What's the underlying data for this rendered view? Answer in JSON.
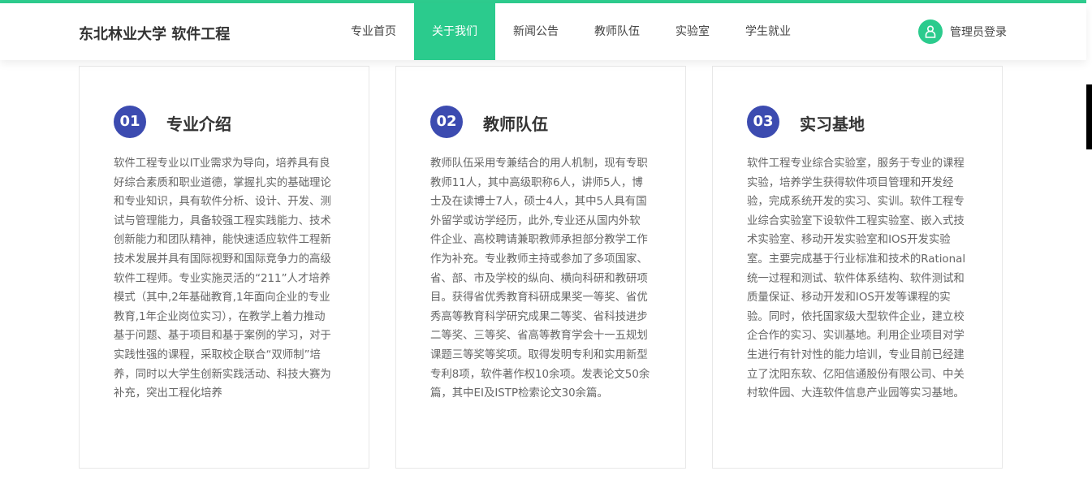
{
  "header": {
    "logo": "东北林业大学 软件工程",
    "nav": [
      "专业首页",
      "关于我们",
      "新闻公告",
      "教师队伍",
      "实验室",
      "学生就业"
    ],
    "active_index": 1,
    "login": "管理员登录"
  },
  "colors": {
    "accent": "#2bcb8d",
    "badge": "#3c4bb0"
  },
  "cards": [
    {
      "num": "01",
      "title": "专业介绍",
      "body": "软件工程专业以IT业需求为导向，培养具有良好综合素质和职业道德，掌握扎实的基础理论和专业知识，具有软件分析、设计、开发、测试与管理能力，具备较强工程实践能力、技术创新能力和团队精神，能快速适应软件工程新技术发展并具有国际视野和国际竞争力的高级软件工程师。专业实施灵活的“211”人才培养模式（其中,2年基础教育,1年面向企业的专业教育,1年企业岗位实习），在教学上着力推动基于问题、基于项目和基于案例的学习，对于实践性强的课程，采取校企联合“双师制”培养，同时以大学生创新实践活动、科技大赛为补充，突出工程化培养"
    },
    {
      "num": "02",
      "title": "教师队伍",
      "body": "教师队伍采用专兼结合的用人机制，现有专职教师11人，其中高级职称6人，讲师5人，博士及在读博士7人，硕士4人，其中5人具有国外留学或访学经历，此外,专业还从国内外软件企业、高校聘请兼职教师承担部分教学工作作为补充。专业教师主持或参加了多项国家、省、部、市及学校的纵向、横向科研和教研项目。获得省优秀教育科研成果奖一等奖、省优秀高等教育科学研究成果二等奖、省科技进步二等奖、三等奖、省高等教育学会十一五规划课题三等奖等奖项。取得发明专利和实用新型专利8项，软件著作权10余项。发表论文50余篇，其中EI及ISTP检索论文30余篇。"
    },
    {
      "num": "03",
      "title": "实习基地",
      "body": "软件工程专业综合实验室，服务于专业的课程实验，培养学生获得软件项目管理和开发经验，完成系统开发的实习、实训。软件工程专业综合实验室下设软件工程实验室、嵌入式技术实验室、移动开发实验室和IOS开发实验室。主要完成基于行业标准和技术的Rational统一过程和测试、软件体系结构、软件测试和质量保证、移动开发和IOS开发等课程的实验。同时，依托国家级大型软件企业，建立校企合作的实习、实训基地。利用企业项目对学生进行有针对性的能力培训，专业目前已经建立了沈阳东软、亿阳信通股份有限公司、中关村软件园、大连软件信息产业园等实习基地。"
    }
  ]
}
